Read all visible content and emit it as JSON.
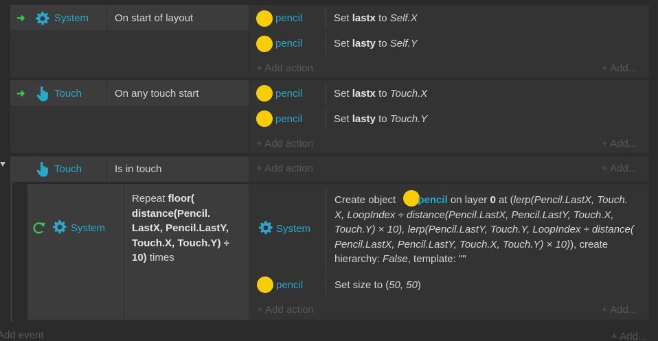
{
  "events": [
    {
      "object": "System",
      "condition": "On start of layout",
      "actions": [
        {
          "object": "pencil",
          "verb": "Set",
          "var": "lastx",
          "to": "to",
          "value": "Self.X"
        },
        {
          "object": "pencil",
          "verb": "Set",
          "var": "lasty",
          "to": "to",
          "value": "Self.Y"
        }
      ]
    },
    {
      "object": "Touch",
      "condition": "On any touch start",
      "actions": [
        {
          "object": "pencil",
          "verb": "Set",
          "var": "lastx",
          "to": "to",
          "value": "Touch.X"
        },
        {
          "object": "pencil",
          "verb": "Set",
          "var": "lasty",
          "to": "to",
          "value": "Touch.Y"
        }
      ]
    },
    {
      "object": "Touch",
      "condition": "Is in touch"
    }
  ],
  "sub_event": {
    "object": "System",
    "condition_line1_prefix": "Repeat ",
    "condition_line1_bold": "floor(",
    "condition_line2": "distance(Pencil.",
    "condition_line3": "LastX, Pencil.LastY,",
    "condition_line4": "Touch.X, Touch.Y) ÷",
    "condition_line5_bold": "10)",
    "condition_line5_suffix": " times",
    "action1_object": "System",
    "action1": {
      "l1_a": "Create object ",
      "l1_obj": "pencil",
      "l1_b": " on layer ",
      "l1_layer": "0",
      "l1_c": " at (",
      "l1_d": "lerp(Pencil.LastX, Touch.",
      "l2": "X, LoopIndex ÷ distance(Pencil.LastX, Pencil.LastY, Touch.X,",
      "l3": "Touch.Y) × 10), lerp(Pencil.LastY, Touch.Y, LoopIndex ÷ distance(",
      "l4_italic": "Pencil.LastX, Pencil.LastY, Touch.X, Touch.Y) × 10)",
      "l4_tail": "), create",
      "l5_a": "hierarchy: ",
      "l5_false": "False",
      "l5_b": ", template: \"\""
    },
    "action2_object": "pencil",
    "action2_verb": "Set size to (",
    "action2_value": "50, 50",
    "action2_end": ")"
  },
  "labels": {
    "add_action": "Add action",
    "add_more": "Add...",
    "add_event": "Add event",
    "plus": "+"
  },
  "colors": {
    "accent_teal": "#2aa8c9",
    "trigger_green": "#3cc45a",
    "pencil_yellow": "#f7cd07"
  },
  "icons": {
    "trigger": "green-arrow-icon",
    "system": "gear-icon",
    "touch": "touch-hand-icon",
    "loop": "loop-icon",
    "collapse": "collapse-triangle-icon"
  }
}
